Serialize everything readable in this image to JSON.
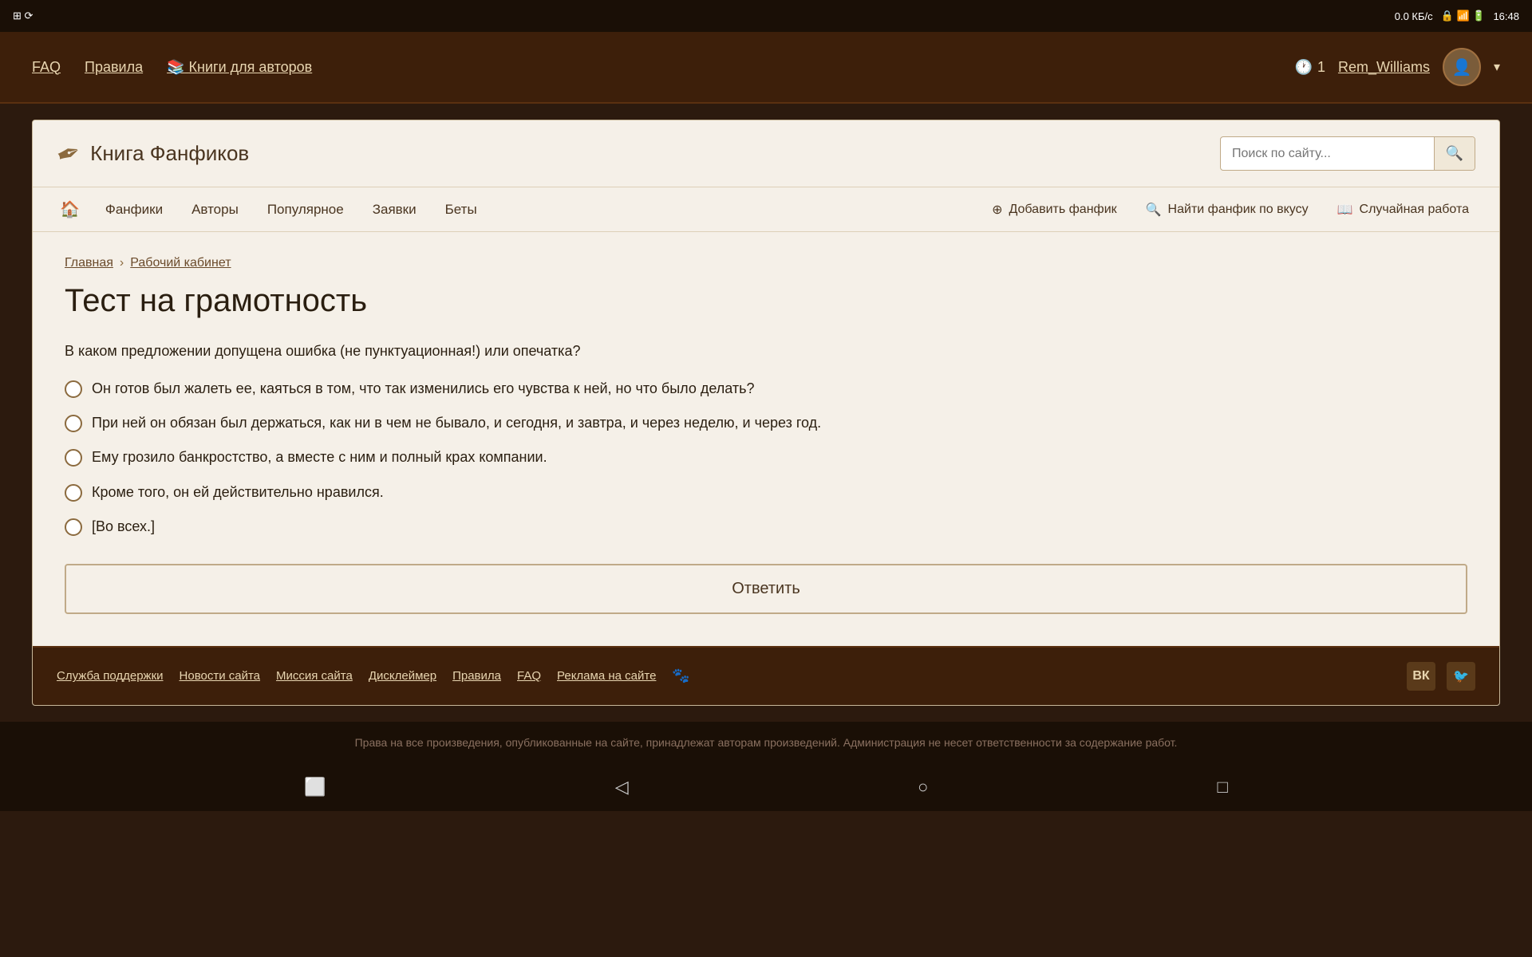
{
  "statusBar": {
    "speed": "0.0 КБ/с",
    "time": "16:48"
  },
  "topNav": {
    "faq": "FAQ",
    "rules": "Правила",
    "booksForAuthors": "Книги для авторов",
    "notifCount": "1",
    "username": "Rem_Williams",
    "dropdownArrow": "▾"
  },
  "siteHeader": {
    "logoText": "Книга Фанфиков",
    "searchPlaceholder": "Поиск по сайту..."
  },
  "mainNav": {
    "home": "🏠",
    "items": [
      {
        "label": "Фанфики"
      },
      {
        "label": "Авторы"
      },
      {
        "label": "Популярное"
      },
      {
        "label": "Заявки"
      },
      {
        "label": "Беты"
      }
    ],
    "actions": [
      {
        "icon": "+",
        "label": "Добавить фанфик"
      },
      {
        "icon": "🔍",
        "label": "Найти фанфик по вкусу"
      },
      {
        "icon": "📖",
        "label": "Случайная работа"
      }
    ]
  },
  "breadcrumb": {
    "home": "Главная",
    "separator": "›",
    "current": "Рабочий кабинет"
  },
  "page": {
    "title": "Тест на грамотность",
    "question": "В каком предложении допущена ошибка (не пунктуационная!) или опечатка?",
    "options": [
      "Он готов был жалеть ее, каяться в том, что так изменились его чувства к ней, но что было делать?",
      "При ней он обязан был держаться, как ни в чем не бывало, и сегодня, и завтра, и через неделю, и через год.",
      "Ему грозило банкростство, а вместе с ним и полный крах компании.",
      "Кроме того, он ей действительно нравился.",
      "[Во всех.]"
    ],
    "submitButton": "Ответить"
  },
  "footer": {
    "links": [
      "Служба поддержки",
      "Новости сайта",
      "Миссия сайта",
      "Дисклеймер",
      "Правила",
      "FAQ",
      "Реклама на сайте"
    ]
  },
  "copyright": "Права на все произведения, опубликованные на сайте, принадлежат авторам произведений. Администрация не несет ответственности за содержание работ.",
  "androidNav": {
    "multiwindow": "⬜",
    "back": "◁",
    "home": "○",
    "recents": "□"
  }
}
